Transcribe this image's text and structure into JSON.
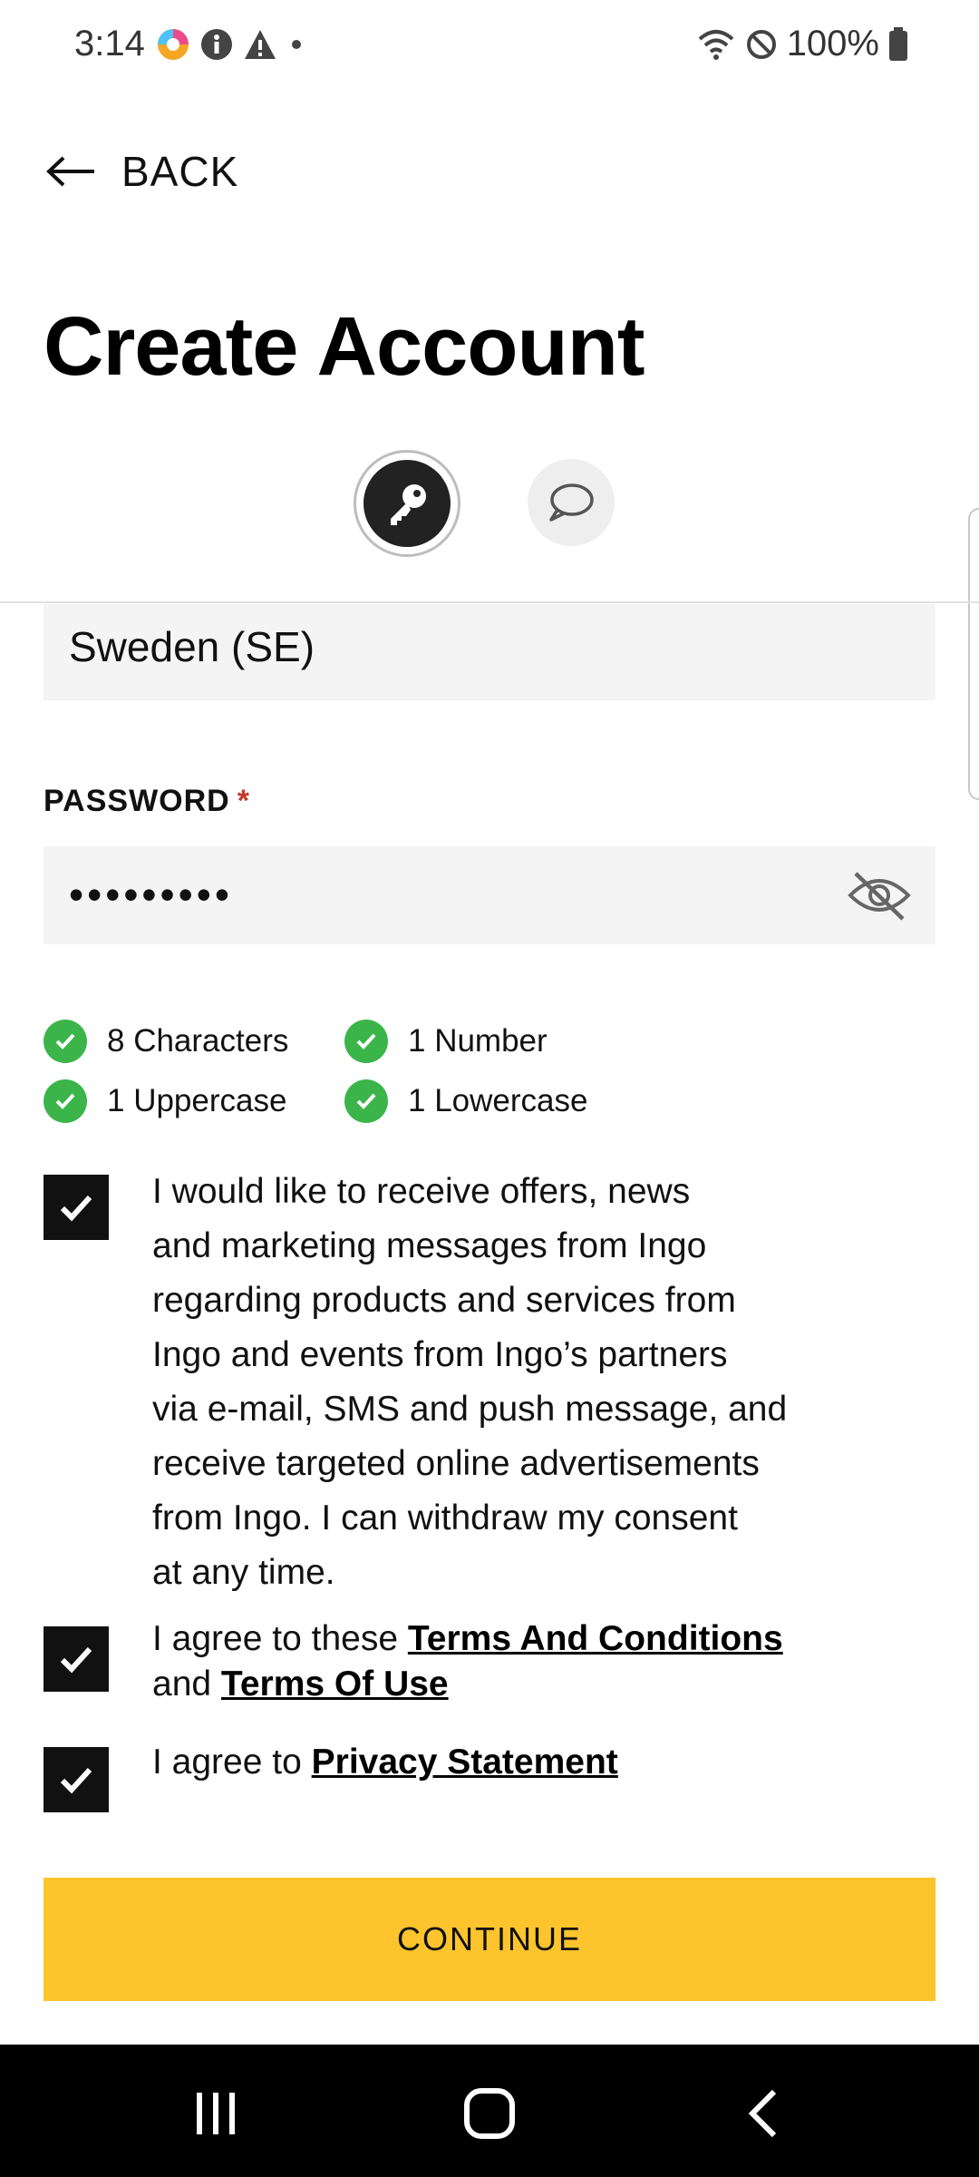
{
  "status_bar": {
    "time": "3:14",
    "battery": "100%"
  },
  "header": {
    "back_label": "BACK",
    "title": "Create Account"
  },
  "form": {
    "country_value": "Sweden (SE)",
    "password_label": "PASSWORD",
    "required_mark": "*",
    "password_value": "•••••••••"
  },
  "password_rules": [
    {
      "label": "8 Characters",
      "met": true
    },
    {
      "label": "1 Number",
      "met": true
    },
    {
      "label": "1 Uppercase",
      "met": true
    },
    {
      "label": "1 Lowercase",
      "met": true
    }
  ],
  "consents": {
    "marketing": {
      "checked": true,
      "lines": [
        "I would like to receive offers, news",
        "and marketing messages from Ingo",
        "regarding products and services from",
        "Ingo and events from Ingo’s partners",
        "via e-mail, SMS and push message, and",
        "receive targeted online advertisements",
        "from Ingo. I can withdraw my consent",
        "at any time."
      ]
    },
    "terms": {
      "checked": true,
      "prefix": "I agree to these ",
      "link1": "Terms And Conditions",
      "middle": "and ",
      "link2": "Terms Of Use"
    },
    "privacy": {
      "checked": true,
      "prefix": "I agree to ",
      "link": "Privacy Statement"
    }
  },
  "actions": {
    "continue_label": "CONTINUE"
  },
  "colors": {
    "accent": "#fec42d",
    "success": "#3bb54a",
    "required": "#c0392b"
  },
  "icons": {
    "steps": [
      "key-icon",
      "chat-bubble-icon"
    ],
    "password_toggle": "eye-off-icon"
  }
}
